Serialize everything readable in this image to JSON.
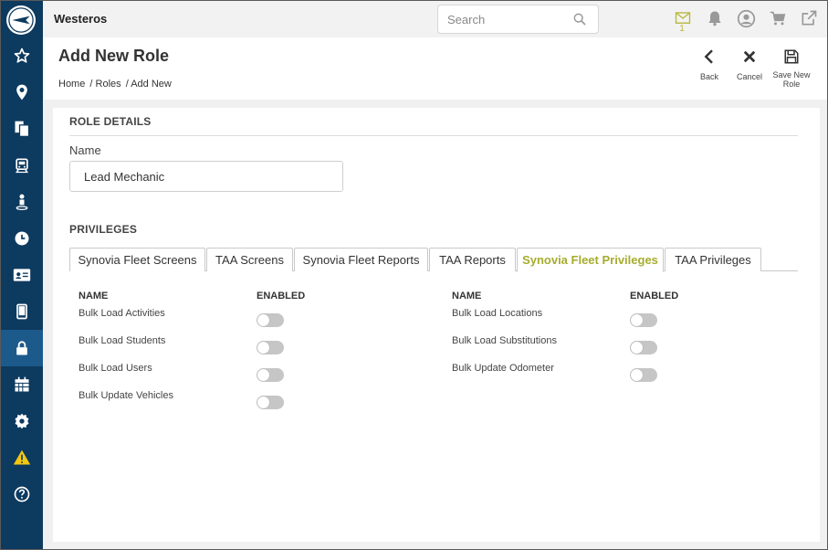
{
  "app": {
    "title": "Westeros"
  },
  "search": {
    "placeholder": "Search"
  },
  "notifications": {
    "mail_count": "1"
  },
  "page": {
    "title": "Add New Role"
  },
  "breadcrumb": [
    "Home",
    "/ Roles",
    "/ Add New"
  ],
  "actions": {
    "back": "Back",
    "cancel": "Cancel",
    "save_line1": "Save New",
    "save_line2": "Role"
  },
  "role_details": {
    "heading": "ROLE DETAILS",
    "name_label": "Name",
    "name_value": "Lead Mechanic"
  },
  "privileges": {
    "heading": "PRIVILEGES",
    "tabs": [
      "Synovia Fleet Screens",
      "TAA Screens",
      "Synovia Fleet Reports",
      "TAA Reports",
      "Synovia Fleet Privileges",
      "TAA Privileges"
    ],
    "active_tab": "Synovia Fleet Privileges",
    "col_name": "NAME",
    "col_enabled": "ENABLED",
    "left": [
      {
        "name": "Bulk Load Activities",
        "enabled": false
      },
      {
        "name": "Bulk Load Students",
        "enabled": false
      },
      {
        "name": "Bulk Load Users",
        "enabled": false
      },
      {
        "name": "Bulk Update Vehicles",
        "enabled": false
      }
    ],
    "right": [
      {
        "name": "Bulk Load Locations",
        "enabled": false
      },
      {
        "name": "Bulk Load Substitutions",
        "enabled": false
      },
      {
        "name": "Bulk Update Odometer",
        "enabled": false
      }
    ]
  },
  "sidebar": {
    "icons": [
      "star-icon",
      "map-pin-icon",
      "documents-icon",
      "bus-icon",
      "person-pin-icon",
      "clock-icon",
      "id-card-icon",
      "tablet-icon",
      "lock-icon",
      "calendar-icon",
      "gear-icon",
      "warning-icon",
      "help-icon"
    ],
    "active": "lock-icon"
  },
  "colors": {
    "sidebar": "#0d3a5f",
    "sidebar_active": "#1c5a8c",
    "accent": "#a6ad2d",
    "warning": "#f2c811"
  }
}
